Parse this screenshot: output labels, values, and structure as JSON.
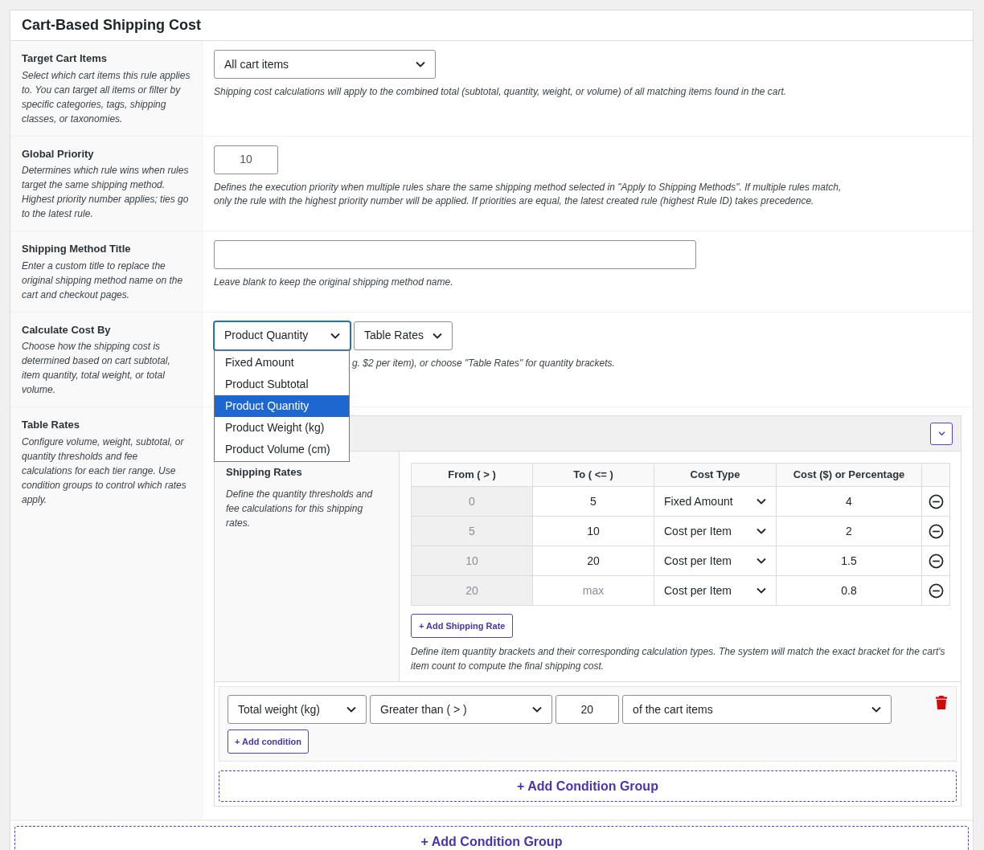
{
  "title": "Cart-Based Shipping Cost",
  "fields": [
    {
      "kind": "select",
      "label": "Target Cart Items",
      "description": "Select which cart items this rule applies to. You can target all items or filter by specific categories, tags, shipping classes, or taxonomies.",
      "value": "All cart items",
      "hint": "Shipping cost calculations will apply to the combined total (subtotal, quantity, weight, or volume) of all matching items found in the cart."
    },
    {
      "kind": "number",
      "label": "Global Priority",
      "description": "Determines which rule wins when rules target the same shipping method. Highest priority number applies; ties go to the latest rule.",
      "value": "10",
      "hint": "Defines the execution priority when multiple rules share the same shipping method selected in \"Apply to Shipping Methods\". If multiple rules match, only the rule with the highest priority number will be applied. If priorities are equal, the latest created rule (highest Rule ID) takes precedence."
    },
    {
      "kind": "text",
      "label": "Shipping Method Title",
      "description": "Enter a custom title to replace the original shipping method name on the cart and checkout pages.",
      "hint": "Leave blank to keep the original shipping method name."
    },
    {
      "kind": "calc",
      "label": "Calculate Cost By",
      "description": "Choose how the shipping cost is determined based on cart subtotal, item quantity, total weight, or total volume.",
      "selects": [
        {
          "value": "Product Quantity",
          "expanded": true,
          "options": [
            {
              "label": "Fixed Amount",
              "selected": false
            },
            {
              "label": "Product Subtotal",
              "selected": false
            },
            {
              "label": "Product Quantity",
              "selected": true
            },
            {
              "label": "Product Weight (kg)",
              "selected": false
            },
            {
              "label": "Product Volume (cm)",
              "selected": false
            }
          ]
        },
        {
          "value": "Table Rates",
          "expanded": false
        }
      ],
      "hint": "g. $2 per item), or choose \"Table Rates\" for quantity brackets."
    },
    {
      "kind": "table_rates",
      "label": "Table Rates",
      "description": "Configure volume, weight, subtotal, or quantity thresholds and fee calculations for each tier range. Use condition groups to control which rates apply.",
      "panel": {
        "section_title": "Shipping Rates",
        "section_description": "Define the quantity thresholds and fee calculations for this shipping rates.",
        "columns": [
          "From ( > )",
          "To ( <= )",
          "Cost Type",
          "Cost ($) or Percentage"
        ],
        "rows": [
          {
            "from": "0",
            "to": "5",
            "cost_type": "Fixed Amount",
            "cost": "4"
          },
          {
            "from": "5",
            "to": "10",
            "cost_type": "Cost per Item",
            "cost": "2"
          },
          {
            "from": "10",
            "to": "20",
            "cost_type": "Cost per Item",
            "cost": "1.5"
          },
          {
            "from": "20",
            "placeholder": "max",
            "cost_type": "Cost per Item",
            "cost": "0.8"
          }
        ],
        "add_rate_button": "+ Add Shipping Rate",
        "note": "Define item quantity brackets and their corresponding calculation types. The system will match the exact bracket for the cart's item count to compute the final shipping cost.",
        "conditions": [
          {
            "field": "Total weight (kg)",
            "operator": "Greater than ( > )",
            "value": "20",
            "scope": "of the cart items"
          }
        ],
        "add_condition_button": "+ Add condition",
        "add_group_button": "+ Add Condition Group"
      }
    }
  ],
  "add_group_button": "+ Add Condition Group"
}
